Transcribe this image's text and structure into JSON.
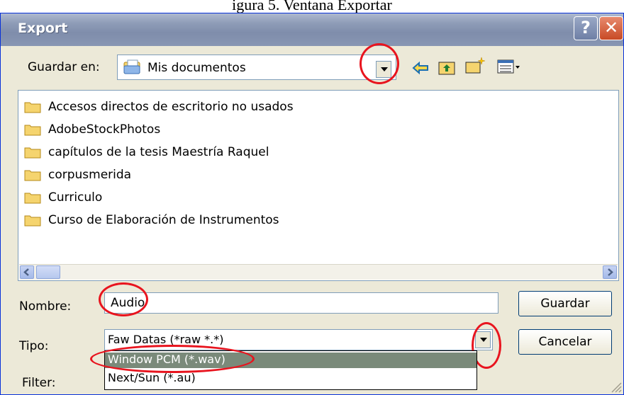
{
  "caption": "igura 5. Ventana Exportar",
  "window": {
    "title": "Export",
    "help_glyph": "?",
    "close_glyph": "✕"
  },
  "save_in": {
    "label": "Guardar en:",
    "value": "Mis documentos"
  },
  "toolbar": {
    "back_icon": "back-arrow-icon",
    "up_icon": "up-folder-icon",
    "new_folder_icon": "new-folder-icon",
    "view_menu_icon": "view-menu-icon"
  },
  "files": [
    {
      "name": "Accesos directos de escritorio no usados"
    },
    {
      "name": "AdobeStockPhotos"
    },
    {
      "name": "capítulos de la tesis Maestría Raquel"
    },
    {
      "name": "corpusmerida"
    },
    {
      "name": "Curriculo"
    },
    {
      "name": "Curso de Elaboración de Instrumentos"
    }
  ],
  "filename": {
    "label": "Nombre:",
    "value": "Audio"
  },
  "filetype": {
    "label": "Tipo:",
    "value": "Faw Datas (*raw *.*)",
    "options": [
      {
        "label": "Window PCM (*.wav)",
        "selected": true
      },
      {
        "label": "Next/Sun (*.au)",
        "selected": false
      }
    ]
  },
  "filter": {
    "label": "Filter:"
  },
  "buttons": {
    "save": "Guardar",
    "cancel": "Cancelar"
  },
  "colors": {
    "annotation_red": "#e8141e",
    "titlebar": "#8e9cb7"
  }
}
